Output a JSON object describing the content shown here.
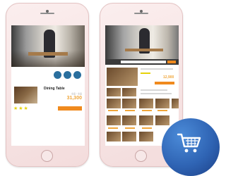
{
  "left_screen": {
    "product_title": "Dining Table",
    "product_sub": "全品・全品",
    "price": "31,300",
    "stars": "★★★"
  },
  "right_screen": {
    "price": "12,900"
  },
  "colors": {
    "accent_orange": "#f08a1e",
    "price_orange": "#f0a63a",
    "dot_blue": "#2a6f9e",
    "star_yellow": "#e6d20a",
    "badge_blue": "#2f64b4"
  },
  "icons": [
    "shopping-cart-icon"
  ]
}
